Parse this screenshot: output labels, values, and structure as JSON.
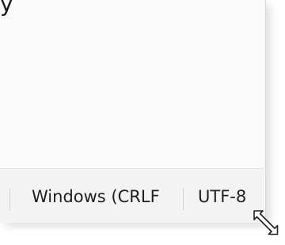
{
  "header_fragment": "y",
  "status_bar": {
    "line_ending_label": "Windows (CRLF",
    "encoding_label": "UTF-8"
  },
  "icons": {
    "resize_grip": "diagonal-resize-arrow-icon"
  },
  "colors": {
    "window_bg": "#f9f9f9",
    "status_bg": "#f3f3f3",
    "separator": "#d4d4d4",
    "text": "#1f1f1f"
  }
}
